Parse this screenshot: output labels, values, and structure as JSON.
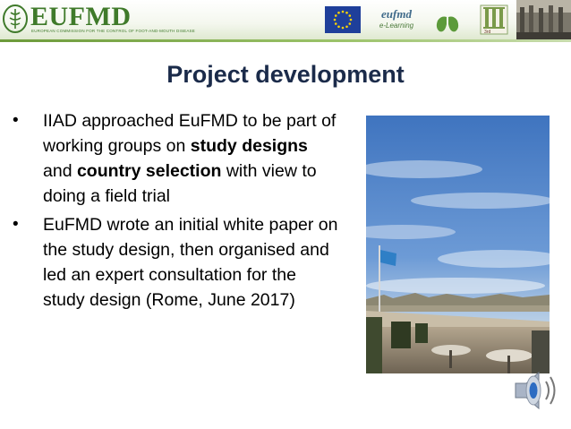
{
  "header": {
    "logo_text": "EUFMD",
    "logo_subtitle": "EUROPEAN COMMISSION FOR THE CONTROL OF FOOT-AND-MOUTH DISEASE",
    "elearning_brand": "eufmd",
    "elearning_label": "e-Learning",
    "pillar_numeral": "III",
    "pillar_caption": "3rd"
  },
  "slide": {
    "title": "Project development",
    "bullets": [
      {
        "parts": [
          {
            "text": "IIAD approached EuFMD to be part of working groups on ",
            "bold": false
          },
          {
            "text": "study designs",
            "bold": true
          },
          {
            "text": " and ",
            "bold": false
          },
          {
            "text": "country selection",
            "bold": true
          },
          {
            "text": " with view to doing a field trial",
            "bold": false
          }
        ]
      },
      {
        "parts": [
          {
            "text": "EuFMD wrote an initial white paper on the study design, then organised and led an expert consultation for the study design (Rome, June 2017)",
            "bold": false
          }
        ]
      }
    ],
    "bullet_glyph": "•"
  },
  "icons": {
    "audio": "speaker-icon"
  },
  "colors": {
    "title": "#1b2b4a",
    "brand_green": "#3f7a2a",
    "eu_blue": "#1f3f9a",
    "eu_star": "#ffd400"
  }
}
